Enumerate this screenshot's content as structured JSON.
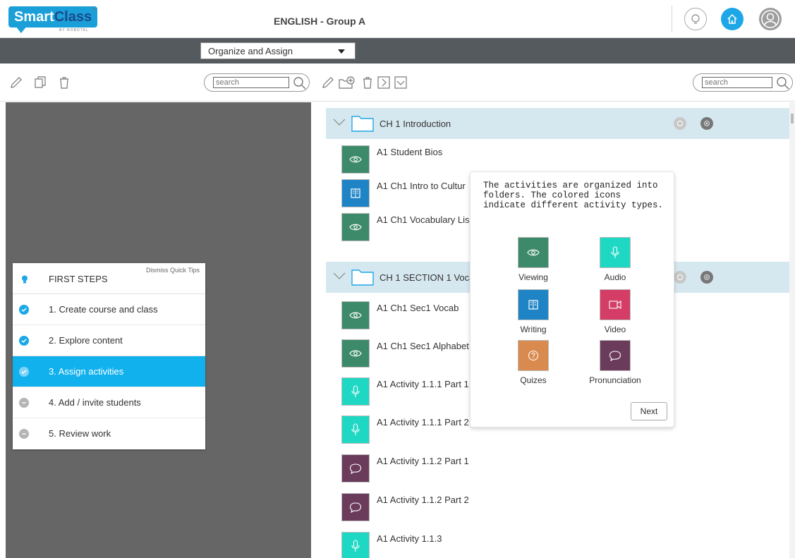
{
  "header": {
    "logo_main": "Smart",
    "logo_class": "Class",
    "logo_reg": "®",
    "logo_sub": "BY ROBOTEL",
    "title": "ENGLISH - Group A"
  },
  "darkbar": {
    "mode": "Organize and Assign"
  },
  "toolbar": {
    "left_search_placeholder": "search",
    "right_search_placeholder": "search"
  },
  "tips": {
    "title": "FIRST STEPS",
    "dismiss": "Dismiss Quick Tips",
    "steps": [
      {
        "label": "1. Create course and class",
        "state": "done"
      },
      {
        "label": "2. Explore content",
        "state": "done"
      },
      {
        "label": "3. Assign activities",
        "state": "active"
      },
      {
        "label": "4. Add / invite students",
        "state": "pending"
      },
      {
        "label": "5. Review work",
        "state": "pending"
      }
    ]
  },
  "content": {
    "folders": [
      {
        "label": "CH 1 Introduction"
      },
      {
        "label": "CH 1 SECTION 1 Voca"
      }
    ],
    "activities": [
      {
        "label": "A1 Student Bios",
        "type": "viewing"
      },
      {
        "label": "A1 Ch1 Intro to Cultur",
        "type": "writing"
      },
      {
        "label": "A1 Ch1 Vocabulary Lis",
        "type": "viewing"
      },
      {
        "label": "A1 Ch1 Sec1 Vocab",
        "type": "viewing"
      },
      {
        "label": "A1 Ch1 Sec1 Alphabet",
        "type": "viewing"
      },
      {
        "label": "A1 Activity 1.1.1 Part 1",
        "type": "audio"
      },
      {
        "label": "A1 Activity 1.1.1 Part 2",
        "type": "audio"
      },
      {
        "label": "A1 Activity 1.1.2 Part 1",
        "type": "pronunciation"
      },
      {
        "label": "A1 Activity 1.1.2 Part 2",
        "type": "pronunciation"
      },
      {
        "label": "A1 Activity 1.1.3",
        "type": "audio"
      }
    ]
  },
  "popup": {
    "message": "The activities are organized into folders. The colored icons indicate different activity types.",
    "legend": [
      {
        "label": "Viewing",
        "type": "viewing"
      },
      {
        "label": "Audio",
        "type": "audio"
      },
      {
        "label": "Writing",
        "type": "writing"
      },
      {
        "label": "Video",
        "type": "video"
      },
      {
        "label": "Quizes",
        "type": "quiz"
      },
      {
        "label": "Pronunciation",
        "type": "pronunciation"
      }
    ],
    "next_label": "Next"
  },
  "colors": {
    "viewing": "#3d8a6a",
    "audio": "#1fd8c4",
    "writing": "#1f84c6",
    "video": "#d43d66",
    "quiz": "#d98a4e",
    "pronunciation": "#6b3b5c",
    "accent": "#11b1ee",
    "done": "#1aa9e8",
    "pending": "#b5b5b5"
  },
  "icons": {
    "viewing": "eye-icon",
    "audio": "microphone-icon",
    "writing": "book-icon",
    "video": "video-camera-icon",
    "quiz": "question-icon",
    "pronunciation": "speech-bubble-icon"
  }
}
